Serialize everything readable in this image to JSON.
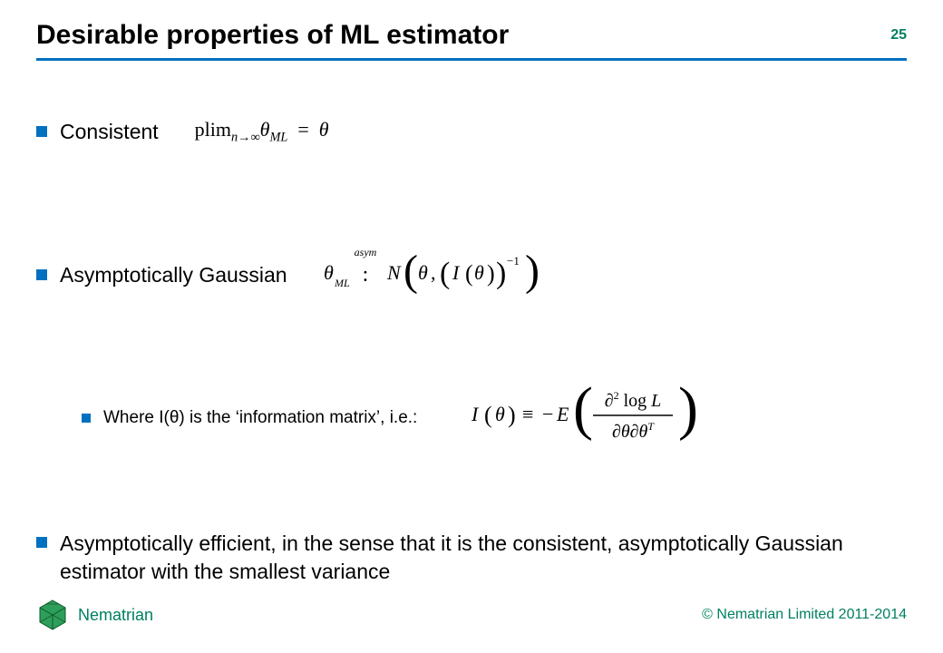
{
  "title": "Desirable properties of ML estimator",
  "page_number": "25",
  "accent_color": "#0070c0",
  "brand_color": "#008060",
  "bullets": {
    "consistent": {
      "label": "Consistent",
      "formula_plain": "plim_{n→∞} θ_ML = θ"
    },
    "asym_gaussian": {
      "label": "Asymptotically Gaussian",
      "formula_plain": "θ_ML ~asym~ N( θ, ( I(θ) )^{-1} )"
    },
    "info_matrix": {
      "label": "Where I(θ) is the ‘information matrix’, i.e.:",
      "formula_plain": "I(θ) ≡ −E( ∂² log L / (∂θ ∂θᵀ) )"
    },
    "asym_efficient": {
      "label": "Asymptotically efficient, in the sense that it is the consistent, asymptotically Gaussian estimator with the smallest variance"
    }
  },
  "footer": {
    "brand": "Nematrian",
    "copyright": "© Nematrian Limited 2011-2014"
  },
  "math_symbols": {
    "theta": "θ",
    "theta_ML": "θ_ML",
    "plim": "plim",
    "n_to_inf": "n→∞",
    "equals": "=",
    "tilde": "∼",
    "asym": "asym",
    "N": "N",
    "I": "I",
    "comma": ",",
    "lparen_big": "(",
    "rparen_big": ")",
    "sup_minus1": "−1",
    "equiv": "≡",
    "minus": "−",
    "E": "E",
    "d2": "∂²",
    "logL": "log L",
    "dtheta": "∂θ",
    "dthetaT": "∂θᵀ"
  }
}
